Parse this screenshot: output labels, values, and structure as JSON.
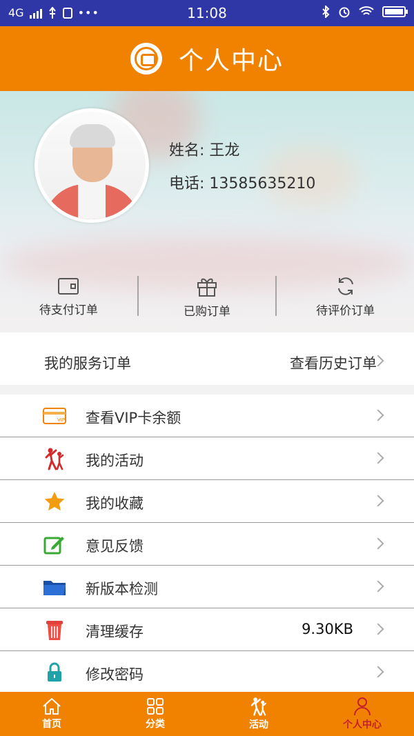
{
  "status_bar": {
    "network": "4G",
    "time": "11:08"
  },
  "header": {
    "title": "个人中心"
  },
  "profile": {
    "name": "姓名: 王龙",
    "phone": "电话: 13585635210"
  },
  "quick_actions": [
    {
      "label": "待支付订单",
      "icon": "wallet-icon"
    },
    {
      "label": "已购订单",
      "icon": "gift-icon"
    },
    {
      "label": "待评价订单",
      "icon": "refresh-icon"
    }
  ],
  "service_orders": {
    "title": "我的服务订单",
    "link": "查看历史订单"
  },
  "menu": [
    {
      "label": "查看VIP卡余额",
      "icon": "vip-card-icon",
      "value": ""
    },
    {
      "label": "我的活动",
      "icon": "dance-icon",
      "value": ""
    },
    {
      "label": "我的收藏",
      "icon": "star-icon",
      "value": ""
    },
    {
      "label": "意见反馈",
      "icon": "edit-icon",
      "value": ""
    },
    {
      "label": "新版本检测",
      "icon": "folder-icon",
      "value": ""
    },
    {
      "label": "清理缓存",
      "icon": "trash-icon",
      "value": "9.30KB"
    },
    {
      "label": "修改密码",
      "icon": "lock-icon",
      "value": ""
    }
  ],
  "tabbar": [
    {
      "label": "首页",
      "icon": "home-icon",
      "active": false
    },
    {
      "label": "分类",
      "icon": "grid-icon",
      "active": false
    },
    {
      "label": "活动",
      "icon": "dance-icon",
      "active": false
    },
    {
      "label": "个人中心",
      "icon": "person-icon",
      "active": true
    }
  ],
  "colors": {
    "primary": "#f08200",
    "status_bar": "#2f37a7",
    "active_tab": "#c3202d"
  }
}
